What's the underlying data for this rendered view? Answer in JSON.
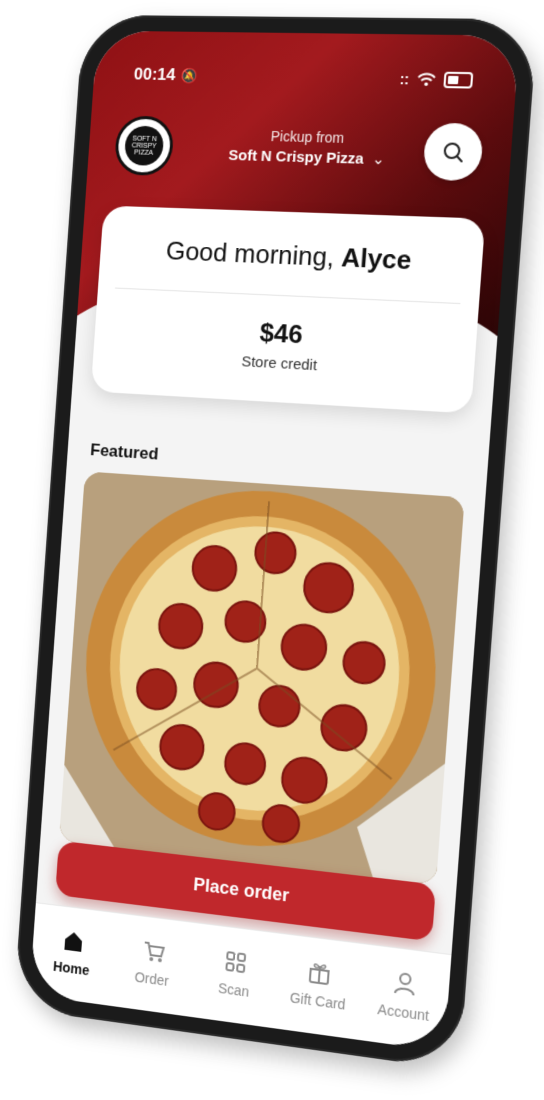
{
  "status_bar": {
    "time": "00:14",
    "signal": "::",
    "wifi_icon": "wifi-icon",
    "battery_icon": "battery-icon"
  },
  "header": {
    "pickup_label": "Pickup from",
    "store_name": "Soft N Crispy Pizza",
    "dropdown_glyph": "⌄",
    "logo_text": "SOFT N CRISPY PIZZA"
  },
  "welcome_card": {
    "greeting": "Good morning,",
    "user_name": "Alyce",
    "credit_amount": "$46",
    "credit_label": "Store credit"
  },
  "featured": {
    "title": "Featured"
  },
  "cta": {
    "label": "Place order"
  },
  "tabs": [
    {
      "label": "Home",
      "icon": "home-icon",
      "active": true
    },
    {
      "label": "Order",
      "icon": "cart-icon",
      "active": false
    },
    {
      "label": "Scan",
      "icon": "qr-icon",
      "active": false
    },
    {
      "label": "Gift Card",
      "icon": "gift-icon",
      "active": false
    },
    {
      "label": "Account",
      "icon": "person-icon",
      "active": false
    }
  ],
  "colors": {
    "brand_red": "#c0282c",
    "hero_dark": "#2a0506"
  }
}
